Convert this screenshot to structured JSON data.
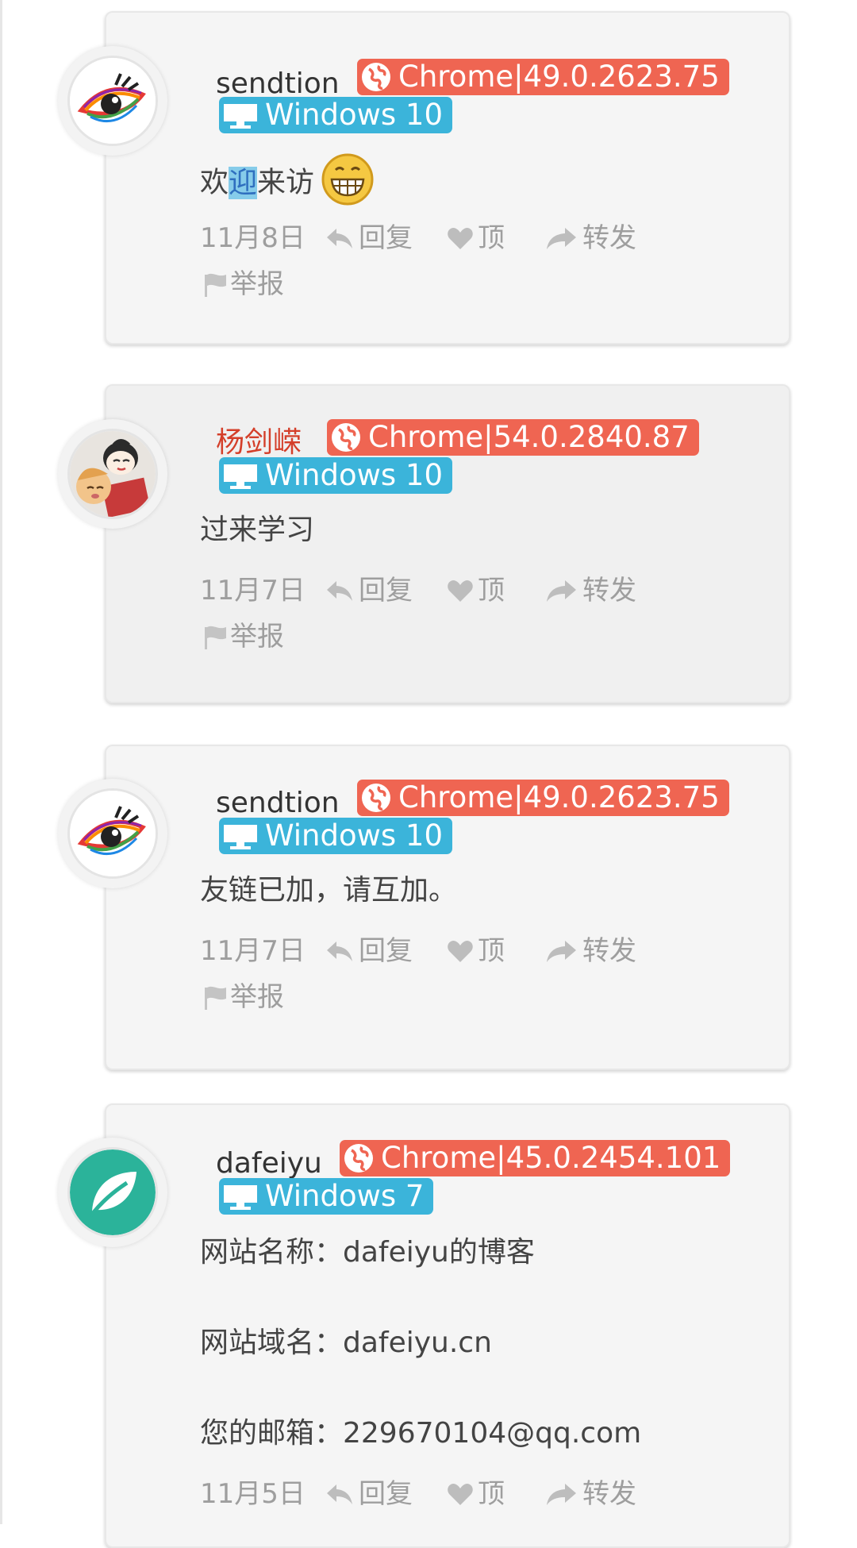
{
  "comments": [
    {
      "name": "sendtion",
      "name_color": "#333333",
      "avatar": "rainbow-eye-avatar",
      "browser": "Chrome|49.0.2623.75",
      "os": "Windows 10",
      "text_before": "欢",
      "text_highlight": "迎",
      "text_after": "来访",
      "emoji": "grinning-face-icon",
      "date": "11月8日",
      "reply": "回复",
      "like": "顶",
      "forward": "转发",
      "report": "举报"
    },
    {
      "name": "杨剑嵘",
      "name_color": "#d43f2a",
      "avatar": "cartoon-characters-avatar",
      "browser": "Chrome|54.0.2840.87",
      "os": "Windows 10",
      "text": "过来学习",
      "date": "11月7日",
      "reply": "回复",
      "like": "顶",
      "forward": "转发",
      "report": "举报"
    },
    {
      "name": "sendtion",
      "name_color": "#333333",
      "avatar": "rainbow-eye-avatar",
      "browser": "Chrome|49.0.2623.75",
      "os": "Windows 10",
      "text": "友链已加，请互加。",
      "date": "11月7日",
      "reply": "回复",
      "like": "顶",
      "forward": "转发",
      "report": "举报"
    },
    {
      "name": "dafeiyu",
      "name_color": "#333333",
      "avatar": "leaf-avatar",
      "browser": "Chrome|45.0.2454.101",
      "os": "Windows 7",
      "lines": [
        "网站名称：dafeiyu的博客",
        "网站域名：dafeiyu.cn",
        "您的邮箱：229670104@qq.com"
      ],
      "date": "11月5日",
      "reply": "回复",
      "like": "顶",
      "forward": "转发"
    }
  ],
  "colors": {
    "browser_badge": "#ef6552",
    "os_badge": "#3bb4da",
    "meta_text": "#9e9e9e",
    "card_bg": "#f5f5f5"
  }
}
